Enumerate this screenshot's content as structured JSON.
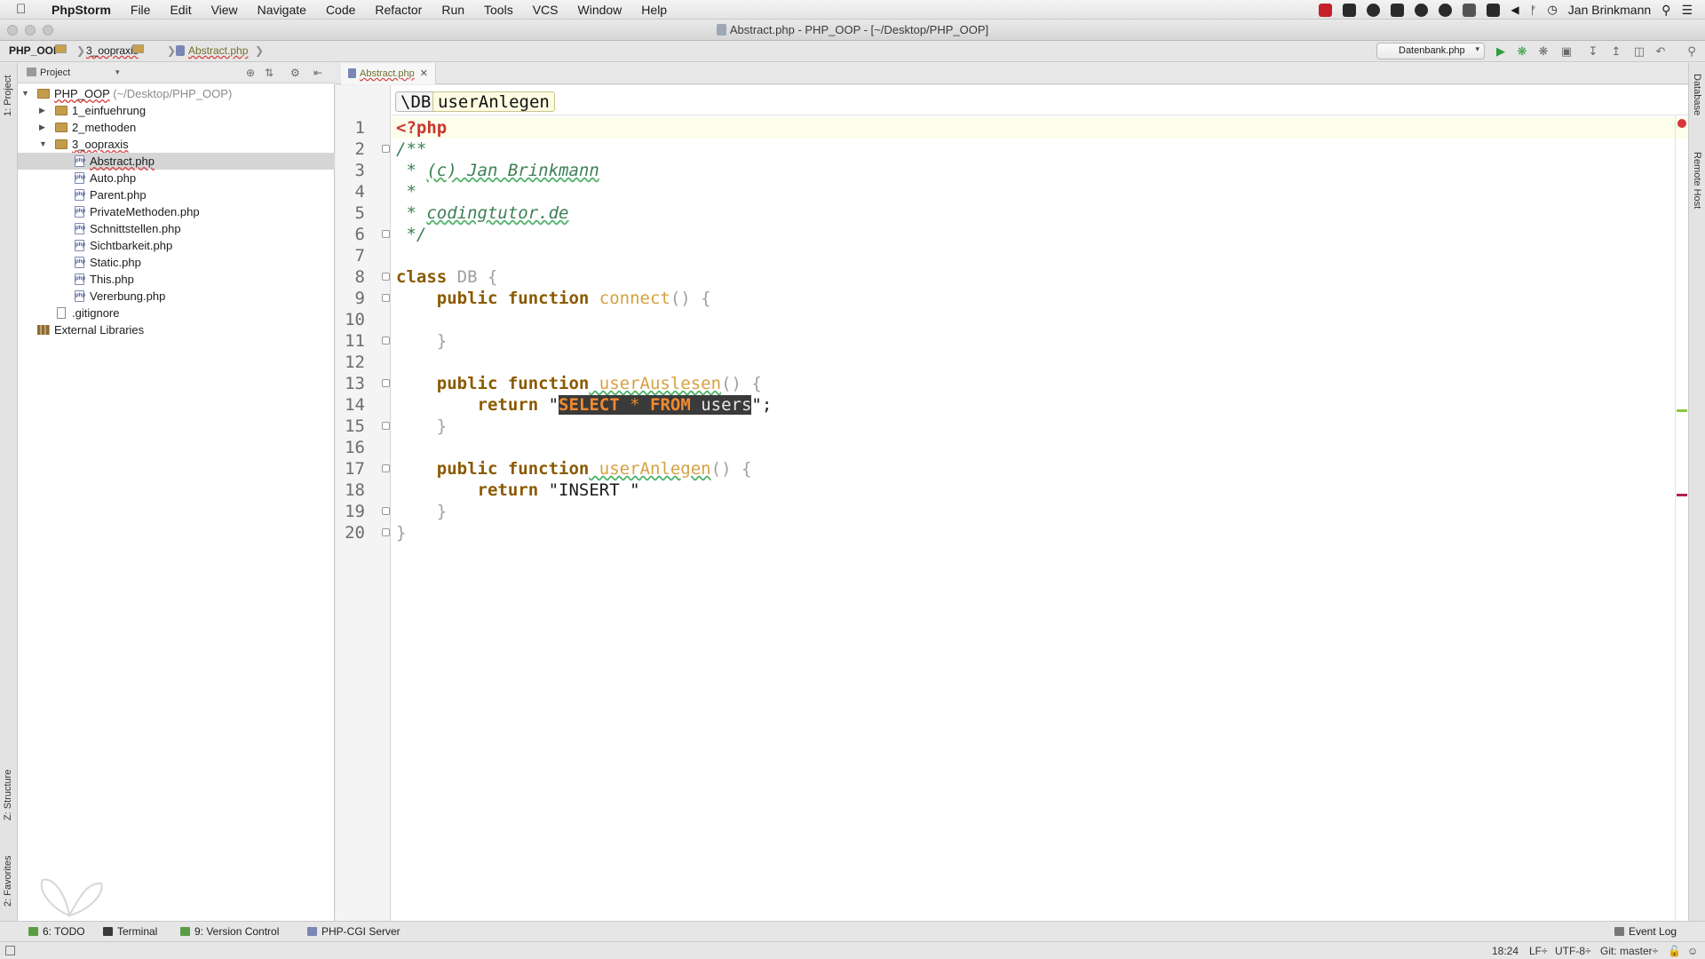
{
  "menubar": {
    "app": "PhpStorm",
    "items": [
      "File",
      "Edit",
      "View",
      "Navigate",
      "Code",
      "Refactor",
      "Run",
      "Tools",
      "VCS",
      "Window",
      "Help"
    ],
    "user": "Jan Brinkmann"
  },
  "window": {
    "title": "Abstract.php - PHP_OOP - [~/Desktop/PHP_OOP]"
  },
  "navbar": {
    "crumbs": [
      "PHP_OOP",
      "3_oopraxis",
      "Abstract.php"
    ],
    "run_config": "Datenbank.php"
  },
  "left_strip": {
    "project": "1: Project",
    "structure": "Z: Structure",
    "favorites": "2: Favorites"
  },
  "right_strip": {
    "database": "Database",
    "remote_host": "Remote Host"
  },
  "project_panel": {
    "title": "Project",
    "tree": [
      {
        "label": "PHP_OOP",
        "suffix": "(~/Desktop/PHP_OOP)"
      },
      {
        "label": "1_einfuehrung"
      },
      {
        "label": "2_methoden"
      },
      {
        "label": "3_oopraxis"
      },
      {
        "label": "Abstract.php"
      },
      {
        "label": "Auto.php"
      },
      {
        "label": "Parent.php"
      },
      {
        "label": "PrivateMethoden.php"
      },
      {
        "label": "Schnittstellen.php"
      },
      {
        "label": "Sichtbarkeit.php"
      },
      {
        "label": "Static.php"
      },
      {
        "label": "This.php"
      },
      {
        "label": "Vererbung.php"
      },
      {
        "label": ".gitignore"
      },
      {
        "label": "External Libraries"
      }
    ]
  },
  "editor": {
    "tab": "Abstract.php",
    "breadcrumb": [
      "\\DB",
      "userAnlegen"
    ],
    "line_numbers": [
      "1",
      "2",
      "3",
      "4",
      "5",
      "6",
      "7",
      "8",
      "9",
      "10",
      "11",
      "12",
      "13",
      "14",
      "15",
      "16",
      "17",
      "18",
      "19",
      "20"
    ],
    "code": {
      "l1": "<?php",
      "l2": "/**",
      "l3_a": " * ",
      "l3_b": "(c) Jan Brinkmann",
      "l4": " *",
      "l5_a": " * ",
      "l5_b": "codingtutor.de",
      "l6": " */",
      "l8_kw": "class",
      "l8_name": " DB ",
      "l8_b": "{",
      "l9_kw": "    public function",
      "l9_fn": " connect",
      "l9_b": "() {",
      "l11": "    }",
      "l13_kw": "    public function",
      "l13_fn": " userAuslesen",
      "l13_b": "() {",
      "l14_kw": "        return",
      "l14_q1": " \"",
      "l14_s1": "SELECT",
      "l14_s2": " * ",
      "l14_s3": "FROM",
      "l14_s4": " users",
      "l14_q2": "\";",
      "l15": "    }",
      "l17_kw": "    public function",
      "l17_fn": " userAnlegen",
      "l17_b": "() {",
      "l18_kw": "        return",
      "l18_s": " \"INSERT \"",
      "l19": "    }",
      "l20": "}"
    }
  },
  "bottom_tools": {
    "todo": "6: TODO",
    "terminal": "Terminal",
    "vcs": "9: Version Control",
    "php_cgi": "PHP-CGI Server",
    "event_log": "Event Log"
  },
  "statusbar": {
    "position": "18:24",
    "line_sep": "LF÷",
    "encoding": "UTF-8÷",
    "git": "Git: master÷"
  },
  "colors": {
    "keyword": "#000080",
    "function_name": "#d7a040",
    "comment": "#3d7f54",
    "php_tag": "#c9372c",
    "sql_keyword": "#f08a30"
  }
}
